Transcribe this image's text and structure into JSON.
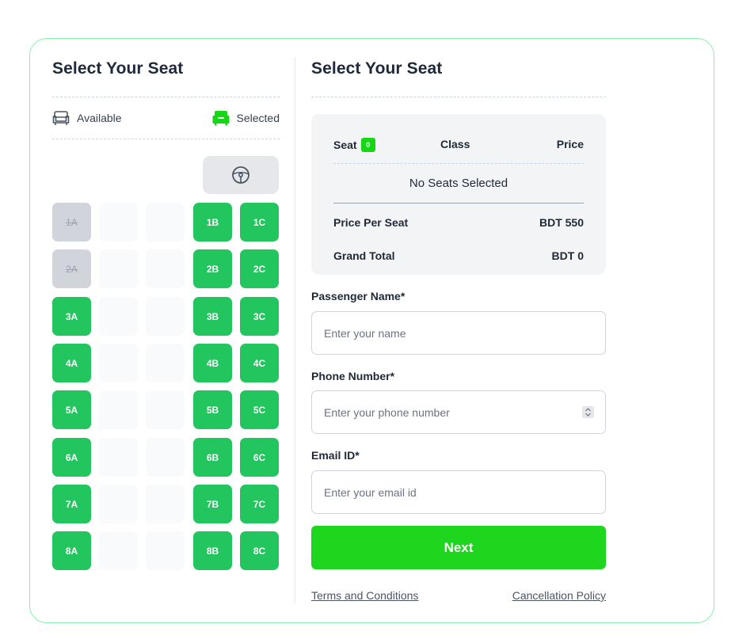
{
  "left": {
    "title": "Select Your Seat",
    "legend": {
      "available": "Available",
      "selected": "Selected"
    }
  },
  "seats": {
    "rows": [
      [
        "1A",
        "",
        "",
        "1B",
        "1C"
      ],
      [
        "2A",
        "",
        "",
        "2B",
        "2C"
      ],
      [
        "3A",
        "",
        "",
        "3B",
        "3C"
      ],
      [
        "4A",
        "",
        "",
        "4B",
        "4C"
      ],
      [
        "5A",
        "",
        "",
        "5B",
        "5C"
      ],
      [
        "6A",
        "",
        "",
        "6B",
        "6C"
      ],
      [
        "7A",
        "",
        "",
        "7B",
        "7C"
      ],
      [
        "8A",
        "",
        "",
        "8B",
        "8C"
      ]
    ],
    "booked": [
      "1A",
      "2A"
    ]
  },
  "right": {
    "title": "Select Your Seat",
    "summary": {
      "seat_header": "Seat",
      "seat_count": "0",
      "class_header": "Class",
      "price_header": "Price",
      "empty_text": "No Seats Selected",
      "price_per_seat_label": "Price Per Seat",
      "price_per_seat_value": "BDT 550",
      "grand_total_label": "Grand Total",
      "grand_total_value": "BDT 0"
    },
    "form": {
      "name_label": "Passenger Name*",
      "name_placeholder": "Enter your name",
      "phone_label": "Phone Number*",
      "phone_placeholder": "Enter your phone number",
      "email_label": "Email ID*",
      "email_placeholder": "Enter your email id"
    },
    "next_label": "Next",
    "terms_link": "Terms and Conditions",
    "cancel_link": "Cancellation Policy"
  },
  "colors": {
    "seat_available": "#22c55e",
    "seat_booked": "#d1d5db",
    "next_button": "#1ed61e",
    "card_border": "#86efac"
  },
  "icons": {
    "available": "armchair-outline-icon",
    "selected": "armchair-filled-icon",
    "driver": "steering-wheel-icon",
    "stepper": "spinner-arrows-icon"
  }
}
